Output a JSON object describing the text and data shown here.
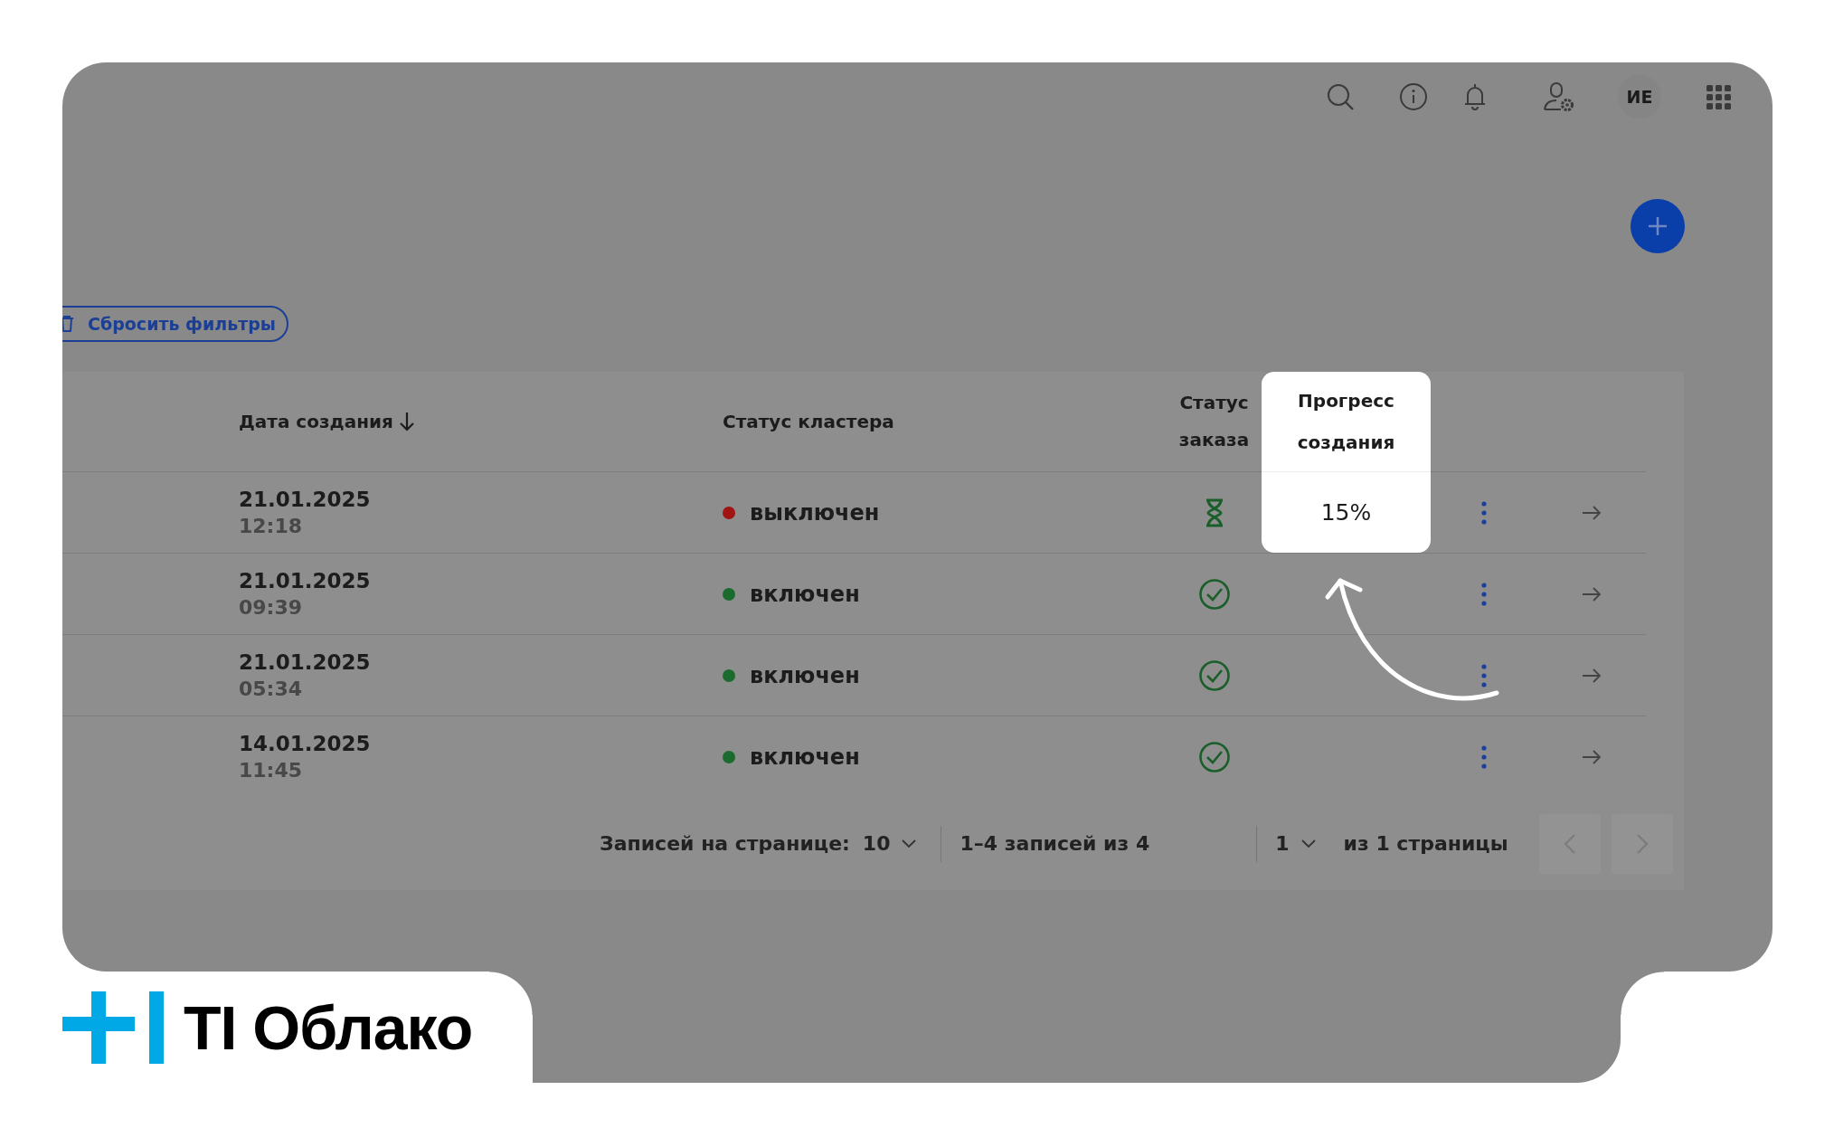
{
  "topbar": {
    "avatar": "ИЕ"
  },
  "reset_filters": "Сбросить фильтры",
  "table": {
    "columns": [
      {
        "label": "Дата создания",
        "sorted": true,
        "highlighted": false
      },
      {
        "label": "Статус кластера",
        "sorted": false,
        "highlighted": false
      },
      {
        "label": "Статус заказа",
        "sorted": false,
        "highlighted": false
      },
      {
        "label": "Прогресс создания",
        "sorted": false,
        "highlighted": true
      }
    ],
    "rows": [
      {
        "date": "21.01.2025",
        "time": "12:18",
        "cluster_status": "выключен",
        "color": "#a01414",
        "kind": "pending",
        "progress": "15%"
      },
      {
        "date": "21.01.2025",
        "time": "09:39",
        "cluster_status": "включен",
        "color": "#1b6b2e",
        "kind": "done"
      },
      {
        "date": "21.01.2025",
        "time": "05:34",
        "cluster_status": "включен",
        "color": "#1b6b2e",
        "kind": "done"
      },
      {
        "date": "14.01.2025",
        "time": "11:45",
        "cluster_status": "включен",
        "color": "#1b6b2e",
        "kind": "done"
      }
    ]
  },
  "pagination": {
    "rows_per_page_label": "Записей на странице:",
    "rows_per_page": "10",
    "range": "1–4 записей из 4",
    "page": "1",
    "pages": "из 1 страницы",
    "prev_disabled": true,
    "next_disabled": true
  },
  "brand": "TI Облако"
}
